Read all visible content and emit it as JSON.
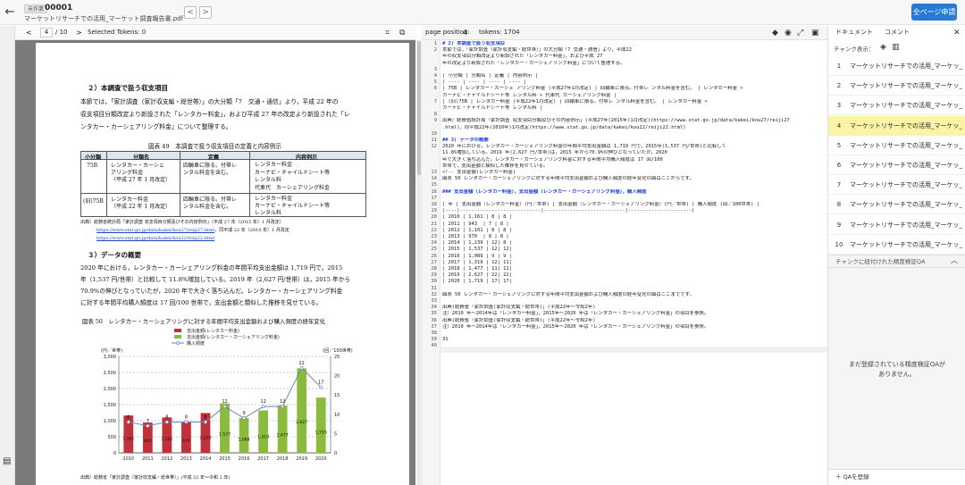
{
  "header": {
    "badge": "未作業",
    "doc_id": "00001",
    "doc_name": "マーケットリサーチでの活用_マーケット調査報告書.pdf",
    "prev": "<",
    "next": ">",
    "primary_button": "全ページ申請"
  },
  "pdf_toolbar": {
    "prev": "<",
    "page_value": "4",
    "page_total": "/ 10",
    "next": ">",
    "selected_tokens": "Selected Tokens: 0"
  },
  "editor_toolbar": {
    "page_position_label": "page position:",
    "page_position_value": "4",
    "tokens": "tokens: 1704"
  },
  "pdf_page": {
    "heading1": "２）本調査で扱う収支項目",
    "para1": [
      "本節では，「家計調査（家計収支編・総世帯）」の大分類「7　交通・通信」より，平成 22 年の",
      "収支項目分類改定より新設された「レンタカー料金」，および平成 27 年の改定より新設された「レ",
      "ンタカー・カーシェアリング料金」について整理する。"
    ],
    "table_title": "図表 49　本調査で扱う収支項目の定義と内容例示",
    "table_headers": [
      "小分類",
      "分類名",
      "定義",
      "内容例示"
    ],
    "table_rows": [
      {
        "code": "75B",
        "name": [
          "レンタカー・カーシェ",
          "アリング料金",
          "（平成 27 年 1 月改定）"
        ],
        "def": [
          "四輪車に限る。付帯レ",
          "ンタル料金を含む。"
        ],
        "ex": [
          "レンタカー料金",
          "カーナビ・チャイルドシート等",
          "レンタル料",
          "代車代　カーシェアリング料金"
        ]
      },
      {
        "code": "(旧)75B",
        "name": [
          "レンタカー料金",
          "（平成 22 年 1 月改定）"
        ],
        "def": [
          "四輪車に限る。付帯レ",
          "ンタル料金を含む。"
        ],
        "ex": [
          "レンタカー料金",
          "カーナビ・チャイルドシート等",
          "レンタル料"
        ]
      }
    ],
    "source1": [
      "出典）総務省統計局「家計調査 収支項目分類及びその内容例示」（平成 27 年（2015 年）1 月改定）"
    ],
    "link1": "https://www.stat.go.jp/data/kakei/kou27/reiji27.html",
    "source1b": "，同平成 22 年（2010 年）1 月改定",
    "link2": "https://www.stat.go.jp/data/kakei/kou22/reiji22.html",
    "heading2": "３）データの概要",
    "para2": [
      "2020 年における，レンタカー・カーシェアリング料金の年間平均支出金額は 1,719 円で，2015",
      "年（1,537 円/世帯）と比較して 11.8%増加している。2019 年（2,627 円/世帯）は，2015 年から",
      "70.9%の伸びとなっていたが，2020 年で大きく落ち込んだ。レンタカー・カーシェアリング料金",
      "に対する年間平均購入頻度は 17 回/100 世帯で，支出金額と類似した推移を見せている。"
    ],
    "chart_title": "図表 50　レンタカー・カーシェアリングに対する年間平均支出金額および購入頻度の経年変化",
    "chart_source": "出典）総務省「家計調査（家計収支編・総世帯）」(平成 22 年〜令和 2 年)"
  },
  "chart_data": {
    "type": "bar",
    "categories": [
      "2010",
      "2011",
      "2012",
      "2013",
      "2014",
      "2015",
      "2016",
      "2017",
      "2018",
      "2019",
      "2020"
    ],
    "series": [
      {
        "name": "支出金額(レンタカー料金)",
        "kind": "bar",
        "axis": "left",
        "values": [
          1161,
          943,
          1101,
          970,
          1239,
          null,
          null,
          null,
          null,
          null,
          null
        ],
        "color": "#c0313a"
      },
      {
        "name": "支出金額(レンタカー・カーシェアリング料金)",
        "kind": "bar",
        "axis": "left",
        "values": [
          null,
          null,
          null,
          null,
          null,
          1537,
          1089,
          1319,
          1477,
          2627,
          1719
        ],
        "color": "#8bbb3c"
      },
      {
        "name": "購入頻度",
        "kind": "line",
        "axis": "right",
        "values": [
          8,
          7,
          8,
          8,
          8,
          12,
          9,
          12,
          12,
          22,
          17
        ],
        "color": "#6e86b8"
      }
    ],
    "ylabel_left": "(円／世帯)",
    "ylabel_right": "(回／100世帯)",
    "ylim_left": [
      0,
      3000
    ],
    "ylim_right": [
      0,
      25
    ],
    "yticks_left": [
      "0",
      "500",
      "1,000",
      "1,500",
      "2,000",
      "2,500",
      "3,000"
    ],
    "yticks_right": [
      "0",
      "5",
      "10",
      "15",
      "20",
      "25"
    ],
    "bar_labels": [
      "1,161",
      "943",
      "1,101",
      "970",
      "1,239",
      "1,537",
      "1,089",
      "1,319",
      "1,477",
      "2,627",
      "1,719"
    ],
    "line_labels": [
      "8",
      "7",
      "8",
      "8",
      "8",
      "12",
      "9",
      "12",
      "12",
      "22",
      "17"
    ],
    "grid": true,
    "legend_position": "top"
  },
  "editor_lines": [
    {
      "n": "1",
      "t": "# 2) 本調査で扱う収支項目",
      "h": true
    },
    {
      "n": "2",
      "t": "本節では，「家計調査（家計収支編・総世帯）」の大分類「7 交通・通信」より，平成22"
    },
    {
      "n": "",
      "t": "年の収支項目分類改定より新設された「レンタカー料金」，および平成 27"
    },
    {
      "n": "",
      "t": "年の改定より新設された「レンタカー・カーシェアリング料金」について整理する。"
    },
    {
      "n": "3",
      "t": ""
    },
    {
      "n": "4",
      "t": "| 小分類 | 分類名 | 定義 | 内容例示 |"
    },
    {
      "n": "5",
      "t": "| ---- | ---- | ---- | ---- |"
    },
    {
      "n": "6",
      "t": "| 75B | レンタカー・カーシェ アリング料金 (平成27年1月改定) | 四輪車に限る。付帯レ ンタル料金を含む。 | レンタカー料金 >"
    },
    {
      "n": "",
      "t": "カーナビ・チャイルドシート等 レンタル料 > 代車代 カーシェアリング料金 |"
    },
    {
      "n": "7",
      "t": "| (旧)75B | レンタカー料金 (平成22年1月改定) | 四輪車に限る。付帯レ ンタル料金を含む。 | レンタカー料金 >"
    },
    {
      "n": "",
      "t": "カーナビ・チャイルドシート等 レンタル料 |"
    },
    {
      "n": "8",
      "t": ""
    },
    {
      "n": "9",
      "t": "出典）総務省統計局「家計調査 収支項目分類及びその内容例示」(平成27年(2015年)1月改定)(https://www.stat.go.jp/data/kakei/kou27/reiji27"
    },
    {
      "n": "",
      "t": ".html)，同平成22年(2010年)1月改定(https://www.stat.go.jp/data/kakei/kou22/reiji22.html)"
    },
    {
      "n": "10",
      "t": ""
    },
    {
      "n": "11",
      "t": "## 3) データの概要",
      "h": true
    },
    {
      "n": "12",
      "t": "2020 年における，レンタカー・カーシェアリング料金の年間平均支出金額は 1,719 円で，2015年(1,537 円/世帯)と比較して"
    },
    {
      "n": "",
      "t": "11.8%増加している。2019 年(2,627 円/世帯)は，2015 年から70.9%の伸びとなっていたが，2020"
    },
    {
      "n": "",
      "t": "年で大きく落ち込んだ。レンタカー・カーシェアリング料金に対する年間平均購入頻度は 17 回/100"
    },
    {
      "n": "",
      "t": "世帯で，支出金額と類似した推移を見せている。"
    },
    {
      "n": "13",
      "t": "<!-- 支出金額(レンタカー料金)"
    },
    {
      "n": "14",
      "t": "図表 50 レンタカー・カーシェアリングに対する年間平均支出金額および購入頻度の経年変化の図はここからです。"
    },
    {
      "n": "15",
      "t": ""
    },
    {
      "n": "16",
      "t": "### 支出金額（レンタカー料金），支出金額（レンタカー・カーシェアリング料金），購入頻度",
      "h": true
    },
    {
      "n": "17",
      "t": ""
    },
    {
      "n": "18",
      "t": "| 年 | 支出金額（レンタカー料金）(円／世帯) | 支出金額（レンタカー・カーシェアリング料金）(円／世帯) | 購入頻度 (回／100世帯) |"
    },
    {
      "n": "19",
      "t": "|----|----------------------------|----------------------------|----------------------|"
    },
    {
      "n": "20",
      "t": "| 2010 | 1,161 | 8 | 8 |"
    },
    {
      "n": "21",
      "t": "| 2011 | 943  | 7 | 8 |"
    },
    {
      "n": "22",
      "t": "| 2012 | 1,101 | 8 | 8 |"
    },
    {
      "n": "23",
      "t": "| 2013 | 970  | 8 | 8 |"
    },
    {
      "n": "24",
      "t": "| 2014 | 1,239 | 12| 8 |"
    },
    {
      "n": "25",
      "t": "| 2015 | 1,537 | 12| 12|"
    },
    {
      "n": "26",
      "t": "| 2016 | 1,089 | 9 | 9 |"
    },
    {
      "n": "27",
      "t": "| 2017 | 1,319 | 12| 11|"
    },
    {
      "n": "28",
      "t": "| 2018 | 1,477 | 11| 11|"
    },
    {
      "n": "29",
      "t": "| 2019 | 2,627 | 22| 22|"
    },
    {
      "n": "30",
      "t": "| 2020 | 1,719 | 17| 17|"
    },
    {
      "n": "31",
      "t": ""
    },
    {
      "n": "32",
      "t": "図表 50 レンタカー・カーシェアリングに対する年間平均支出金額および購入頻度の経年変化の図はここまでです。"
    },
    {
      "n": "33",
      "t": ""
    },
    {
      "n": "34",
      "t": "出典)総務省「家計調査(家計収支編・総世帯)」(平成22年～令和2年)"
    },
    {
      "n": "35",
      "t": "注）2010 年～2014年は「レンタカー料金」，2015年～2020 年は「レンタカー・カーシェアリング料金」の項目を参照。"
    },
    {
      "n": "36",
      "t": "出典)総務省「家計調査(家計収支編・総世帯)」(平成22年～令和2年)"
    },
    {
      "n": "37",
      "t": "注）2010 年～2014年は「レンタカー料金」，2015年～2020 年は「レンタカー・カーシェアリング料金」の項目を参照。"
    },
    {
      "n": "38",
      "t": ""
    },
    {
      "n": "39",
      "t": "31"
    },
    {
      "n": "40",
      "t": ""
    }
  ],
  "right_panel": {
    "tab_document": "ドキュメント",
    "tab_comment": "コメント",
    "chunk_display_label": "チャンク表示：",
    "chunks": [
      {
        "num": "1",
        "title": "マーケットリサーチでの活用_マーケッ_000"
      },
      {
        "num": "2",
        "title": "マーケットリサーチでの活用_マーケッ_000"
      },
      {
        "num": "3",
        "title": "マーケットリサーチでの活用_マーケッ_000"
      },
      {
        "num": "4",
        "title": "マーケットリサーチでの活用_マーケッ_000"
      },
      {
        "num": "5",
        "title": "マーケットリサーチでの活用_マーケッ_000"
      },
      {
        "num": "6",
        "title": "マーケットリサーチでの活用_マーケッ_000"
      },
      {
        "num": "7",
        "title": "マーケットリサーチでの活用_マーケッ_000"
      },
      {
        "num": "8",
        "title": "マーケットリサーチでの活用_マーケッ_000"
      },
      {
        "num": "9",
        "title": "マーケットリサーチでの活用_マーケッ_000"
      },
      {
        "num": "10",
        "title": "マーケットリサーチでの活用_マーケッ_000"
      }
    ],
    "selected_chunk": "4",
    "qa_header": "チャンクに紐付けれた精度検証QA",
    "qa_empty": [
      "まだ登録されている精度検証QAが",
      "ありません。"
    ],
    "qa_add": "＋  QAを登録"
  },
  "colors": {
    "accent": "#2878d6",
    "selected_row": "#fdf3a5",
    "heading_code": "#1a3ee0"
  }
}
